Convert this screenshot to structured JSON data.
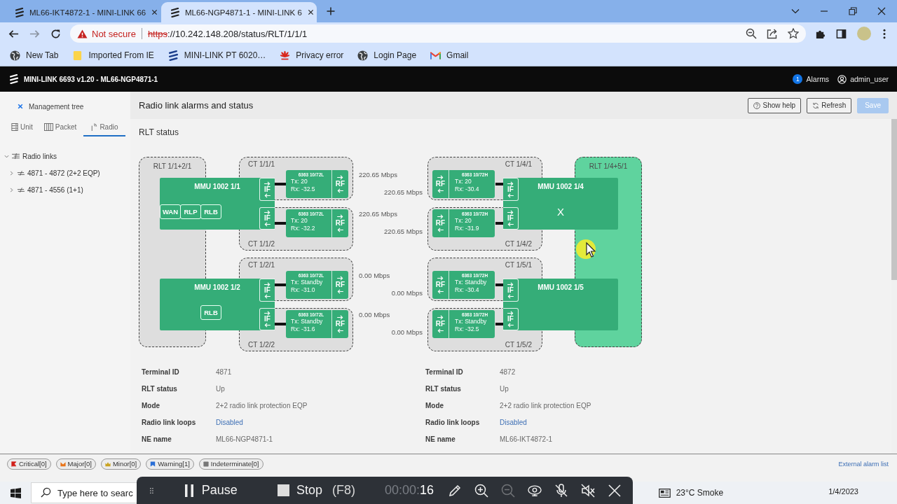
{
  "browser": {
    "tabs": [
      {
        "title": "ML66-IKT4872-1 - MINI-LINK 66",
        "selected": false
      },
      {
        "title": "ML66-NGP4871-1 - MINI-LINK 6",
        "selected": true
      }
    ],
    "address": {
      "security": "Not secure",
      "scheme": "https",
      "rest": "://10.242.148.208/status/RLT/1/1/1"
    },
    "bookmarks": [
      {
        "label": "New Tab",
        "kind": "globe"
      },
      {
        "label": "Imported From IE",
        "kind": "folder"
      },
      {
        "label": "MINI-LINK PT 6020…",
        "kind": "logo"
      },
      {
        "label": "Privacy error",
        "kind": "flower"
      },
      {
        "label": "Login Page",
        "kind": "globe"
      },
      {
        "label": "Gmail",
        "kind": "mail"
      }
    ]
  },
  "app": {
    "title": "MINI-LINK 6693 v1.20 - ML66-NGP4871-1",
    "alarm_count": "1",
    "alarms": "Alarms",
    "user": "admin_user"
  },
  "sidebar": {
    "title": "Management tree",
    "tabs": [
      {
        "label": "Unit",
        "kind": "unit",
        "selected": false
      },
      {
        "label": "Packet",
        "kind": "packet",
        "selected": false
      },
      {
        "label": "Radio",
        "kind": "radio",
        "selected": true
      }
    ],
    "tree": [
      {
        "label": "Radio links",
        "expanded": true,
        "children": [
          {
            "label": "4871 - 4872 (2+2 EQP)",
            "expanded": false
          },
          {
            "label": "4871 - 4556 (1+1)",
            "expanded": false
          }
        ]
      }
    ]
  },
  "page": {
    "title": "Radio link alarms and status",
    "buttons": [
      {
        "label": "Show help",
        "kind": "help",
        "disabled": false
      },
      {
        "label": "Refresh",
        "kind": "refresh",
        "disabled": false
      },
      {
        "label": "Save",
        "kind": "save",
        "disabled": true
      }
    ],
    "section": "RLT status"
  },
  "diagram": {
    "terminals": [
      {
        "label": "RLT 1/1+2/1",
        "highlighted": false,
        "mmus": [
          {
            "name": "MMU 1002 1/1",
            "ports": [
              "WAN",
              "RLP",
              "RLB"
            ],
            "carriers": [
              {
                "ct": "CT 1/1/1",
                "unit": "6363 10/72L",
                "tx": "Tx: 20",
                "rx": "Rx: -32.5",
                "if": "IF",
                "rf": "RF"
              },
              {
                "ct": "CT 1/1/2",
                "unit": "6363 10/72L",
                "tx": "Tx: 20",
                "rx": "Rx: -32.2",
                "if": "IF",
                "rf": "RF"
              }
            ]
          },
          {
            "name": "MMU 1002 1/2",
            "ports": [
              "RLB"
            ],
            "carriers": [
              {
                "ct": "CT 1/2/1",
                "unit": "6363 10/72L",
                "tx": "Tx: Standby",
                "rx": "Rx: -31.0",
                "if": "IF",
                "rf": "RF"
              },
              {
                "ct": "CT 1/2/2",
                "unit": "6363 10/72L",
                "tx": "Tx: Standby",
                "rx": "Rx: -31.6",
                "if": "IF",
                "rf": "RF"
              }
            ]
          }
        ]
      },
      {
        "label": "RLT 1/4+5/1",
        "highlighted": true,
        "mmus": [
          {
            "name": "MMU 1002 1/4",
            "marker": "X",
            "carriers": [
              {
                "ct": "CT 1/4/1",
                "unit": "6363 10/72H",
                "tx": "Tx: 20",
                "rx": "Rx: -30.4",
                "if": "IF",
                "rf": "RF"
              },
              {
                "ct": "CT 1/4/2",
                "unit": "6363 10/72H",
                "tx": "Tx: 20",
                "rx": "Rx: -31.9",
                "if": "IF",
                "rf": "RF"
              }
            ]
          },
          {
            "name": "MMU 1002 1/5",
            "carriers": [
              {
                "ct": "CT 1/5/1",
                "unit": "6363 10/72H",
                "tx": "Tx: Standby",
                "rx": "Rx: -30.4",
                "if": "IF",
                "rf": "RF"
              },
              {
                "ct": "CT 1/5/2",
                "unit": "6363 10/72H",
                "tx": "Tx: Standby",
                "rx": "Rx: -32.5",
                "if": "IF",
                "rf": "RF"
              }
            ]
          }
        ]
      }
    ],
    "rates": [
      {
        "upper": "220.65 Mbps",
        "lower": "220.65 Mbps"
      },
      {
        "upper": "220.65 Mbps",
        "lower": "220.65 Mbps"
      },
      {
        "upper": "0.00 Mbps",
        "lower": "0.00 Mbps"
      },
      {
        "upper": "0.00 Mbps",
        "lower": "0.00 Mbps"
      }
    ]
  },
  "info": {
    "columns": [
      [
        {
          "label": "Terminal ID",
          "value": "4871",
          "kind": "text"
        },
        {
          "label": "RLT status",
          "value": "Up",
          "kind": "text"
        },
        {
          "label": "Mode",
          "value": "2+2 radio link protection EQP",
          "kind": "text"
        },
        {
          "label": "Radio link loops",
          "value": "Disabled",
          "kind": "link"
        },
        {
          "label": "NE name",
          "value": "ML66-NGP4871-1",
          "kind": "text"
        }
      ],
      [
        {
          "label": "Terminal ID",
          "value": "4872",
          "kind": "text"
        },
        {
          "label": "RLT status",
          "value": "Up",
          "kind": "text"
        },
        {
          "label": "Mode",
          "value": "2+2 radio link protection EQP",
          "kind": "text"
        },
        {
          "label": "Radio link loops",
          "value": "Disabled",
          "kind": "link"
        },
        {
          "label": "NE name",
          "value": "ML66-IKT4872-1",
          "kind": "text"
        }
      ]
    ]
  },
  "alarm_bar": {
    "counters": [
      {
        "label": "Critical[0]",
        "kind": "critical"
      },
      {
        "label": "Major[0]",
        "kind": "major"
      },
      {
        "label": "Minor[0]",
        "kind": "minor"
      },
      {
        "label": "Warning[1]",
        "kind": "warning"
      },
      {
        "label": "Indeterminate[0]",
        "kind": "indeterminate"
      }
    ],
    "link": "External alarm list"
  },
  "taskbar": {
    "search": {
      "placeholder": "Type here to searc"
    },
    "weather": "23°C Smoke",
    "date": "1/4/2023"
  },
  "recorder": {
    "pause": "Pause",
    "stop": "Stop",
    "shortcut": "(F8)",
    "timer_faded": "00:00:",
    "timer": "16",
    "tools": [
      {
        "kind": "pen",
        "disabled": false
      },
      {
        "kind": "zoom_in",
        "disabled": false
      },
      {
        "kind": "zoom_out",
        "disabled": true
      },
      {
        "kind": "webcam",
        "disabled": false
      },
      {
        "kind": "mic",
        "disabled": false
      },
      {
        "kind": "speaker",
        "disabled": false
      },
      {
        "kind": "close",
        "disabled": false
      }
    ]
  }
}
